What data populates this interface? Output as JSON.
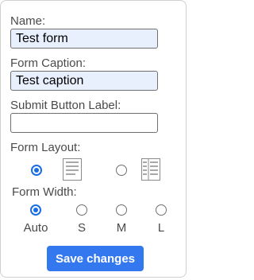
{
  "form": {
    "name_label": "Name:",
    "name_value": "Test form",
    "caption_label": "Form Caption:",
    "caption_value": "Test caption",
    "submit_label_label": "Submit Button Label:",
    "submit_label_value": "",
    "layout_label": "Form Layout:",
    "layout_options": [
      {
        "icon": "single-column-layout-icon",
        "selected": true
      },
      {
        "icon": "table-layout-icon",
        "selected": false
      }
    ],
    "width_label": "Form Width:",
    "width_options": [
      {
        "label": "Auto",
        "selected": true
      },
      {
        "label": "S",
        "selected": false
      },
      {
        "label": "M",
        "selected": false
      },
      {
        "label": "L",
        "selected": false
      }
    ],
    "save_label": "Save changes"
  },
  "colors": {
    "accent": "#1a6de0",
    "button": "#3478f0",
    "autofill": "#e8f0fe"
  }
}
